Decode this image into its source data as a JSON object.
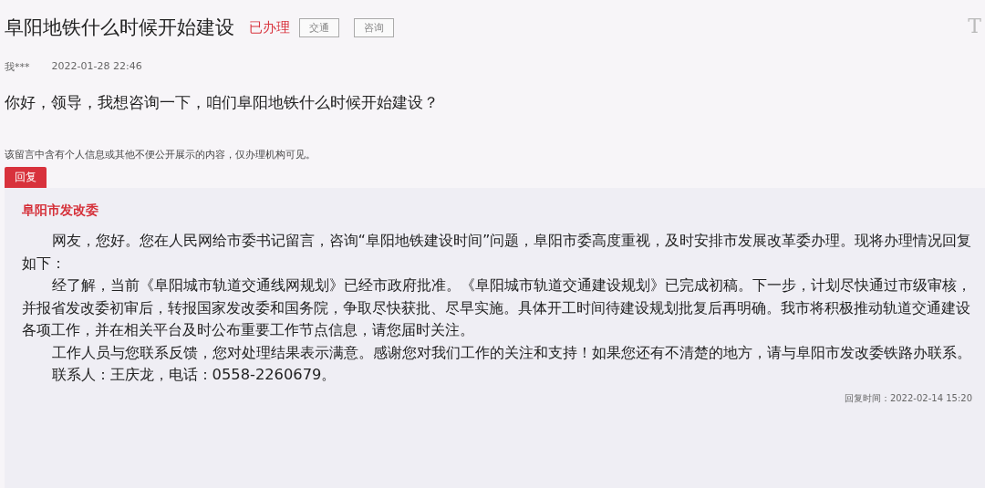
{
  "title": "阜阳地铁什么时候开始建设",
  "status": "已办理",
  "tags": [
    "交通",
    "咨询"
  ],
  "font_size_button": "T",
  "author": "我***",
  "posted_time": "2022-01-28 22:46",
  "question": "你好，领导，我想咨询一下，咱们阜阳地铁什么时候开始建设？",
  "privacy_notice": "该留言中含有个人信息或其他不便公开展示的内容，仅办理机构可见。",
  "reply_button": "回复",
  "reply": {
    "organization": "阜阳市发改委",
    "paragraphs": [
      "网友，您好。您在人民网给市委书记留言，咨询“阜阳地铁建设时间”问题，阜阳市委高度重视，及时安排市发展改革委办理。现将办理情况回复如下：",
      "经了解，当前《阜阳城市轨道交通线网规划》已经市政府批准。《阜阳城市轨道交通建设规划》已完成初稿。下一步，计划尽快通过市级审核，并报省发改委初审后，转报国家发改委和国务院，争取尽快获批、尽早实施。具体开工时间待建设规划批复后再明确。我市将积极推动轨道交通建设各项工作，并在相关平台及时公布重要工作节点信息，请您届时关注。",
      "工作人员与您联系反馈，您对处理结果表示满意。感谢您对我们工作的关注和支持！如果您还有不清楚的地方，请与阜阳市发改委铁路办联系。",
      "联系人：王庆龙，电话：0558-2260679。"
    ],
    "reply_time": "回复时间：2022-02-14 15:20"
  }
}
